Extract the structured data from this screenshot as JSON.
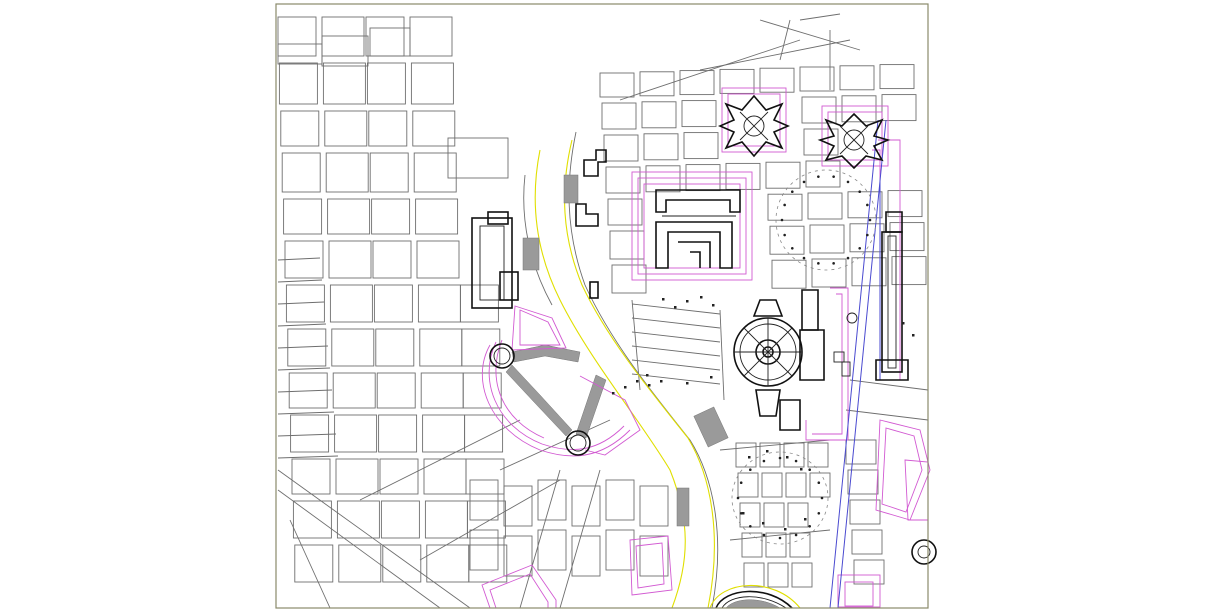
{
  "drawing": {
    "type": "urban-plan-drawing",
    "colors": {
      "frame": "#8a8a6a",
      "streets": "#6e6e6e",
      "river_bank": "#e0df00",
      "landscape_overlay": "#d25ad2",
      "axis_line": "#4a4ad0",
      "buildings": "#111111"
    },
    "layers": [
      {
        "id": "street-grid-west"
      },
      {
        "id": "street-grid-east"
      },
      {
        "id": "river"
      },
      {
        "id": "monuments"
      },
      {
        "id": "plazas-overlay"
      },
      {
        "id": "blue-axis"
      }
    ]
  }
}
